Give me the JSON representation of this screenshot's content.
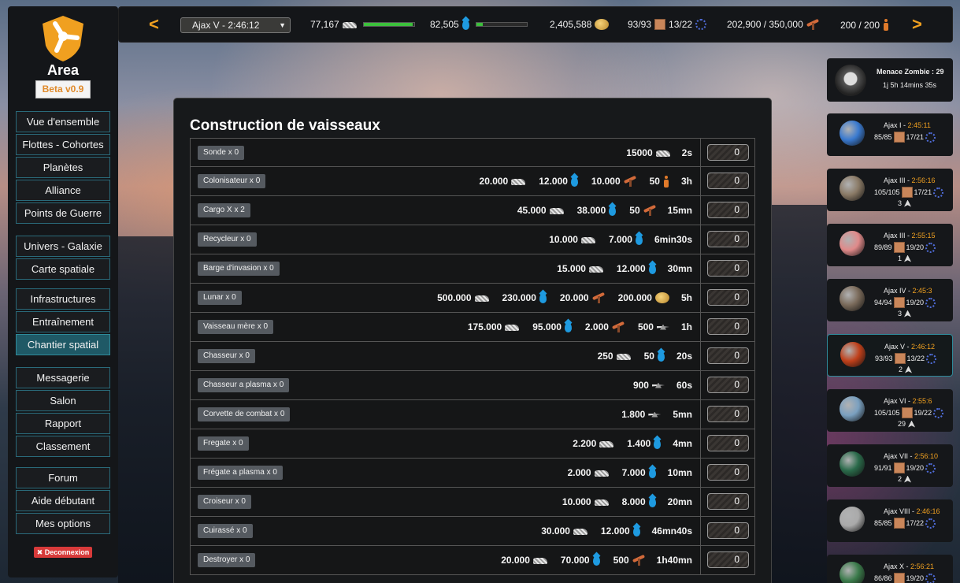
{
  "sidebar": {
    "logo_text": "Area",
    "version": "Beta v0.9",
    "groups": [
      [
        "Vue d'ensemble",
        "Flottes - Cohortes",
        "Planètes",
        "Alliance",
        "Points de Guerre"
      ],
      [
        "Univers - Galaxie",
        "Carte spatiale"
      ],
      [
        "Infrastructures",
        "Entraînement",
        "Chantier spatial"
      ],
      [
        "Messagerie",
        "Salon",
        "Rapport",
        "Classement"
      ],
      [
        "Forum",
        "Aide débutant",
        "Mes options"
      ]
    ],
    "active": "Chantier spatial",
    "logout": "✖ Deconnexion"
  },
  "topbar": {
    "prev": "<",
    "next": ">",
    "planet_select": "Ajax V - 2:46:12",
    "metal": "77,167",
    "metal_fill": 0.97,
    "water": "82,505",
    "water_fill": 0.13,
    "credits": "2,405,588",
    "fields": "93/93",
    "slots": "13/22",
    "workers": "202,900 / 350,000",
    "population": "200 / 200"
  },
  "page": {
    "title": "Construction de vaisseaux"
  },
  "ships": [
    {
      "label": "Sonde x 0",
      "costs": [
        [
          "15000",
          "metal"
        ]
      ],
      "time": "2s",
      "qty": "0"
    },
    {
      "label": "Colonisateur x 0",
      "costs": [
        [
          "20.000",
          "metal"
        ],
        [
          "12.000",
          "water"
        ],
        [
          "10.000",
          "pick"
        ],
        [
          "50",
          "man"
        ]
      ],
      "time": "3h",
      "qty": "0"
    },
    {
      "label": "Cargo X x 2",
      "costs": [
        [
          "45.000",
          "metal"
        ],
        [
          "38.000",
          "water"
        ],
        [
          "50",
          "pick"
        ]
      ],
      "time": "15mn",
      "qty": "0"
    },
    {
      "label": "Recycleur x 0",
      "costs": [
        [
          "10.000",
          "metal"
        ],
        [
          "7.000",
          "water"
        ]
      ],
      "time": "6min30s",
      "qty": "0"
    },
    {
      "label": "Barge d'invasion x 0",
      "costs": [
        [
          "15.000",
          "metal"
        ],
        [
          "12.000",
          "water"
        ]
      ],
      "time": "30mn",
      "qty": "0"
    },
    {
      "label": "Lunar x 0",
      "costs": [
        [
          "500.000",
          "metal"
        ],
        [
          "230.000",
          "water"
        ],
        [
          "20.000",
          "pick"
        ],
        [
          "200.000",
          "coin"
        ]
      ],
      "time": "5h",
      "qty": "0"
    },
    {
      "label": "Vaisseau mère x 0",
      "costs": [
        [
          "175.000",
          "metal"
        ],
        [
          "95.000",
          "water"
        ],
        [
          "2.000",
          "pick"
        ],
        [
          "500",
          "ship"
        ]
      ],
      "time": "1h",
      "qty": "0"
    },
    {
      "label": "Chasseur x 0",
      "costs": [
        [
          "250",
          "metal"
        ],
        [
          "50",
          "water"
        ]
      ],
      "time": "20s",
      "qty": "0"
    },
    {
      "label": "Chasseur a plasma x 0",
      "costs": [
        [
          "900",
          "ship"
        ]
      ],
      "time": "60s",
      "qty": "0"
    },
    {
      "label": "Corvette de combat x 0",
      "costs": [
        [
          "1.800",
          "ship"
        ]
      ],
      "time": "5mn",
      "qty": "0"
    },
    {
      "label": "Fregate x 0",
      "costs": [
        [
          "2.200",
          "metal"
        ],
        [
          "1.400",
          "water"
        ]
      ],
      "time": "4mn",
      "qty": "0"
    },
    {
      "label": "Frégate a plasma x 0",
      "costs": [
        [
          "2.000",
          "metal"
        ],
        [
          "7.000",
          "water"
        ]
      ],
      "time": "10mn",
      "qty": "0"
    },
    {
      "label": "Croiseur x 0",
      "costs": [
        [
          "10.000",
          "metal"
        ],
        [
          "8.000",
          "water"
        ]
      ],
      "time": "20mn",
      "qty": "0"
    },
    {
      "label": "Cuirassé x 0",
      "costs": [
        [
          "30.000",
          "metal"
        ],
        [
          "12.000",
          "water"
        ]
      ],
      "time": "46mn40s",
      "qty": "0"
    },
    {
      "label": "Destroyer x 0",
      "costs": [
        [
          "20.000",
          "metal"
        ],
        [
          "70.000",
          "water"
        ],
        [
          "500",
          "pick"
        ]
      ],
      "time": "1h40mn",
      "qty": "0"
    }
  ],
  "menace": {
    "line1": "Menace Zombie : 29",
    "line2": "1j 5h 14mins 35s"
  },
  "planets": [
    {
      "name": "Ajax I - ",
      "time": "2:45:11",
      "fields": "85/85",
      "slots": "17/21",
      "ships": "",
      "color": "#3a7ad0"
    },
    {
      "name": "Ajax III - ",
      "time": "2:56:16",
      "fields": "105/105",
      "slots": "17/21",
      "ships": "3",
      "color": "#8a7a66"
    },
    {
      "name": "Ajax III - ",
      "time": "2:55:15",
      "fields": "89/89",
      "slots": "19/20",
      "ships": "1",
      "color": "#e08a8a"
    },
    {
      "name": "Ajax IV - ",
      "time": "2:45:3",
      "fields": "94/94",
      "slots": "19/20",
      "ships": "3",
      "color": "#7a6a5a"
    },
    {
      "name": "Ajax V - ",
      "time": "2:46:12",
      "fields": "93/93",
      "slots": "13/22",
      "ships": "2",
      "color": "#c0401a"
    },
    {
      "name": "Ajax VI - ",
      "time": "2:55:6",
      "fields": "105/105",
      "slots": "19/22",
      "ships": "29",
      "color": "#7aa0c0"
    },
    {
      "name": "Ajax VII - ",
      "time": "2:56:10",
      "fields": "91/91",
      "slots": "19/20",
      "ships": "2",
      "color": "#2a6a4a"
    },
    {
      "name": "Ajax VIII - ",
      "time": "2:46:16",
      "fields": "85/85",
      "slots": "17/22",
      "ships": "",
      "color": "#aaaaaa"
    },
    {
      "name": "Ajax X - ",
      "time": "2:56:21",
      "fields": "86/86",
      "slots": "19/20",
      "ships": "",
      "color": "#3a7a4a"
    }
  ],
  "active_planet": 4
}
